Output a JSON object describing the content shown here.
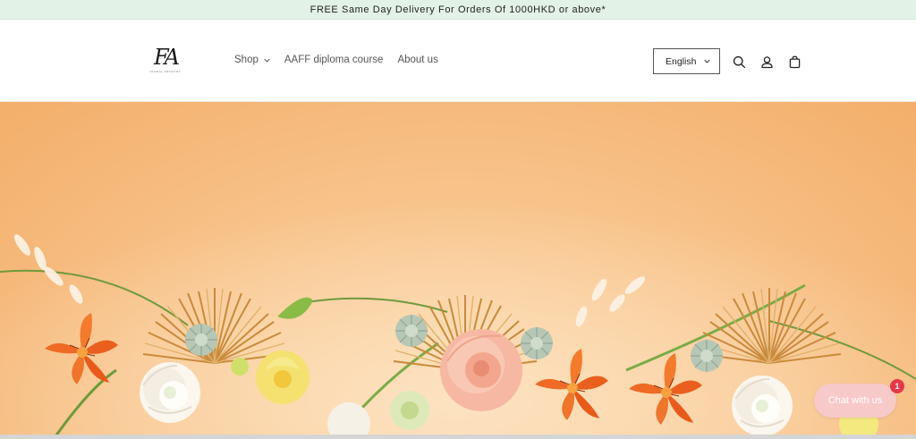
{
  "announcement": {
    "text": "FREE Same Day Delivery For Orders Of 1000HKD or above*",
    "background": "#e3f2e6"
  },
  "header": {
    "logo": {
      "mark": "FA",
      "tagline": "FLORAL ARTISTRY"
    },
    "nav": [
      {
        "label": "Shop",
        "has_dropdown": true
      },
      {
        "label": "AAFF diploma course",
        "has_dropdown": false
      },
      {
        "label": "About us",
        "has_dropdown": false
      }
    ],
    "language": {
      "selected": "English"
    },
    "icons": [
      "search-icon",
      "account-icon",
      "cart-icon"
    ]
  },
  "hero": {
    "image": "floral-arrangement-banner",
    "colors": {
      "background": "#f8c48c",
      "accent_orange": "#f06a22",
      "cream": "#fff8ef",
      "peach": "#f6b8a3"
    }
  },
  "chat": {
    "label": "Chat with us",
    "badge_count": "1",
    "color": "#f7c9c8",
    "badge_color": "#e8364a"
  }
}
